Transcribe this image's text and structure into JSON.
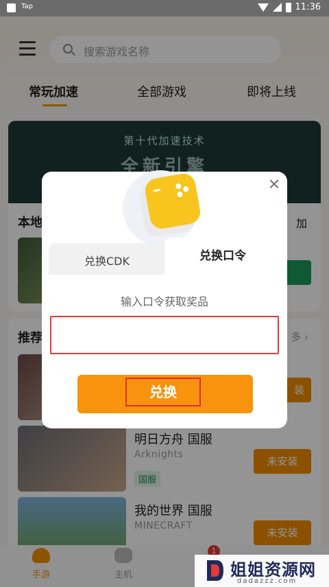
{
  "status_bar": {
    "app_label": "Tap",
    "time": "11:36"
  },
  "header": {
    "search_placeholder": "搜索游戏名称"
  },
  "tabs": [
    "常玩加速",
    "全部游戏",
    "即将上线"
  ],
  "banner": {
    "title": "第十代加速技术",
    "subtitle": "全新引擎"
  },
  "sections": {
    "local_title": "本地",
    "recommend_title": "推荐",
    "more": "多 ›",
    "partial_right_label": "加"
  },
  "games": [
    {
      "name": "明日方舟 国服",
      "subtitle": "Arknights",
      "tag": "国服",
      "button": "未安装"
    },
    {
      "name": "我的世界 国服",
      "subtitle": "MINECRAFT",
      "button": "未安装"
    }
  ],
  "partial_install_label": "装",
  "bottom_nav": {
    "item1": "手游",
    "item2": "主机",
    "badge": "1"
  },
  "modal": {
    "tab_cdk": "兑换CDK",
    "tab_code": "兑换口令",
    "hint": "输入口令获取奖品",
    "input_value": "",
    "button": "兑换",
    "close_icon": "close-icon"
  },
  "watermark": {
    "text": "姐姐资源网",
    "url": "dadazzz.com"
  },
  "colors": {
    "accent": "#f8930d",
    "highlight": "#e23b3b",
    "green": "#1b9a5a"
  }
}
